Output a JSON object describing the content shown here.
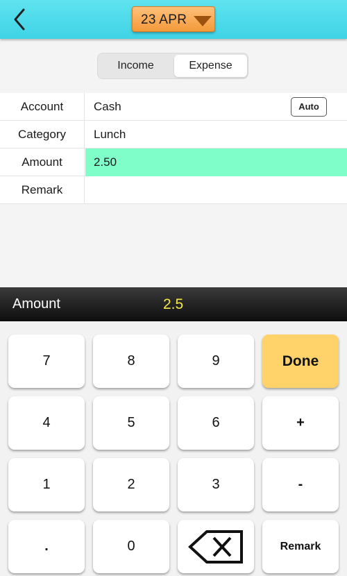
{
  "header": {
    "date": "23 APR"
  },
  "tabs": {
    "income": "Income",
    "expense": "Expense"
  },
  "form": {
    "account_label": "Account",
    "account_value": "Cash",
    "auto_label": "Auto",
    "category_label": "Category",
    "category_value": "Lunch",
    "amount_label": "Amount",
    "amount_value": "2.50",
    "remark_label": "Remark",
    "remark_value": ""
  },
  "keypad": {
    "label": "Amount",
    "value": "2.5",
    "keys": {
      "k7": "7",
      "k8": "8",
      "k9": "9",
      "done": "Done",
      "k4": "4",
      "k5": "5",
      "k6": "6",
      "plus": "+",
      "k1": "1",
      "k2": "2",
      "k3": "3",
      "minus": "-",
      "dot": ".",
      "k0": "0",
      "remark": "Remark"
    }
  },
  "colors": {
    "header": "#4fdbe9",
    "date_button": "#f7a94a",
    "active_field": "#7ffec9",
    "done_key": "#ffd36a",
    "keypad_value": "#f6e84a"
  },
  "icons": {
    "back": "chevron-left-icon",
    "date_dropdown": "caret-down-icon",
    "backspace": "backspace-icon"
  }
}
